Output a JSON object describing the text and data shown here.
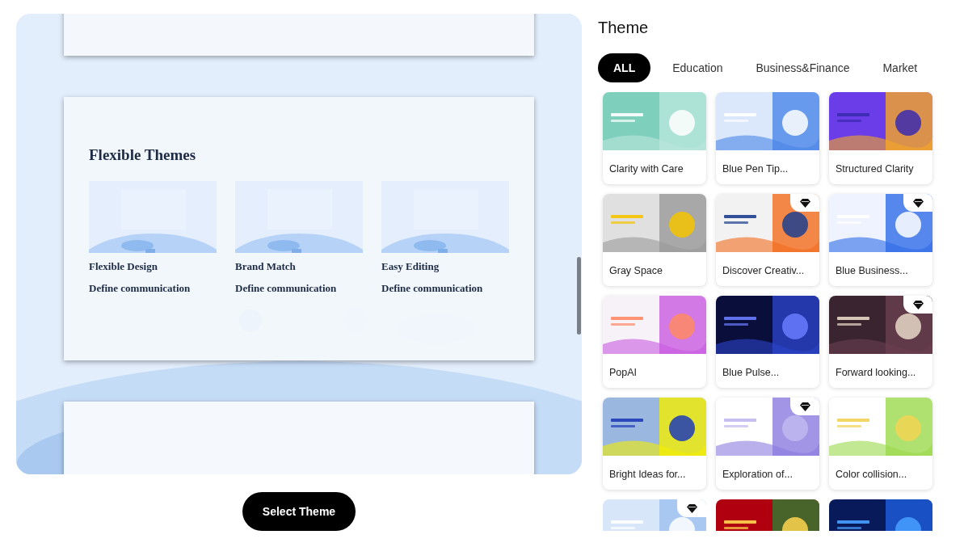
{
  "preview": {
    "slide": {
      "title": "Flexible Themes",
      "columns": [
        {
          "heading": "Flexible Design",
          "text": "Define communication"
        },
        {
          "heading": "Brand Match",
          "text": "Define communication"
        },
        {
          "heading": "Easy Editing",
          "text": "Define communication"
        }
      ]
    }
  },
  "select_button": "Select Theme",
  "theme_panel": {
    "title": "Theme",
    "tabs": [
      {
        "label": "ALL",
        "selected": true
      },
      {
        "label": "Education",
        "selected": false
      },
      {
        "label": "Business&Finance",
        "selected": false
      },
      {
        "label": "Market",
        "selected": false
      }
    ],
    "cards": [
      {
        "title": "Clarity with Care",
        "premium": false
      },
      {
        "title": "Blue Pen Tip...",
        "premium": false
      },
      {
        "title": "Structured Clarity",
        "premium": false
      },
      {
        "title": "Gray Space",
        "premium": false
      },
      {
        "title": "Discover Creativ...",
        "premium": true
      },
      {
        "title": "Blue Business...",
        "premium": true
      },
      {
        "title": "PopAI",
        "premium": false
      },
      {
        "title": "Blue Pulse...",
        "premium": false
      },
      {
        "title": "Forward looking...",
        "premium": true
      },
      {
        "title": "Bright Ideas for...",
        "premium": false
      },
      {
        "title": "Exploration of...",
        "premium": true
      },
      {
        "title": "Color collision...",
        "premium": false
      },
      {
        "premium": true
      },
      {
        "premium": false
      },
      {
        "premium": false
      }
    ]
  }
}
